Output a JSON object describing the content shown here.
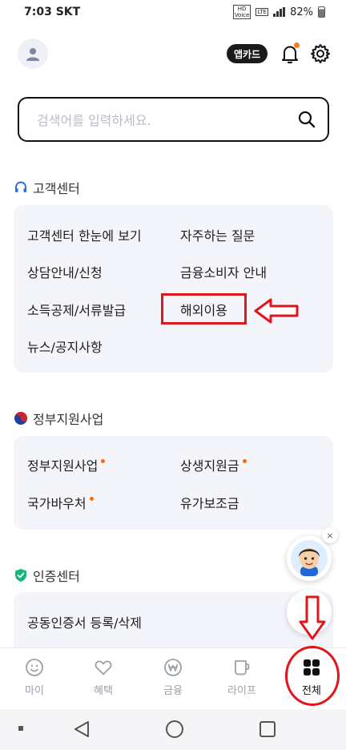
{
  "status": {
    "time": "7:03",
    "carrier": "SKT",
    "hd": "HD",
    "voice": "Voice",
    "lte": "LTE",
    "battery": "82%"
  },
  "header": {
    "appcard_label": "앱카드"
  },
  "search": {
    "placeholder": "검색어를 입력하세요."
  },
  "sections": {
    "customer": {
      "title": "고객센터",
      "items": [
        "고객센터 한눈에 보기",
        "자주하는 질문",
        "상담안내/신청",
        "금융소비자 안내",
        "소득공제/서류발급",
        "해외이용",
        "뉴스/공지사항"
      ]
    },
    "gov": {
      "title": "정부지원사업",
      "items": [
        "정부지원사업",
        "상생지원금",
        "국가바우처",
        "유가보조금"
      ]
    },
    "cert": {
      "title": "인증센터",
      "items": [
        "공동인증서 등록/삭제"
      ]
    }
  },
  "float": {
    "close": "×"
  },
  "tabs": [
    "마이",
    "혜택",
    "금융",
    "라이프",
    "전체"
  ],
  "colors": {
    "annotation_red": "#e0161b",
    "new_dot": "#ff6a00",
    "card_bg": "#f3f5fb"
  }
}
